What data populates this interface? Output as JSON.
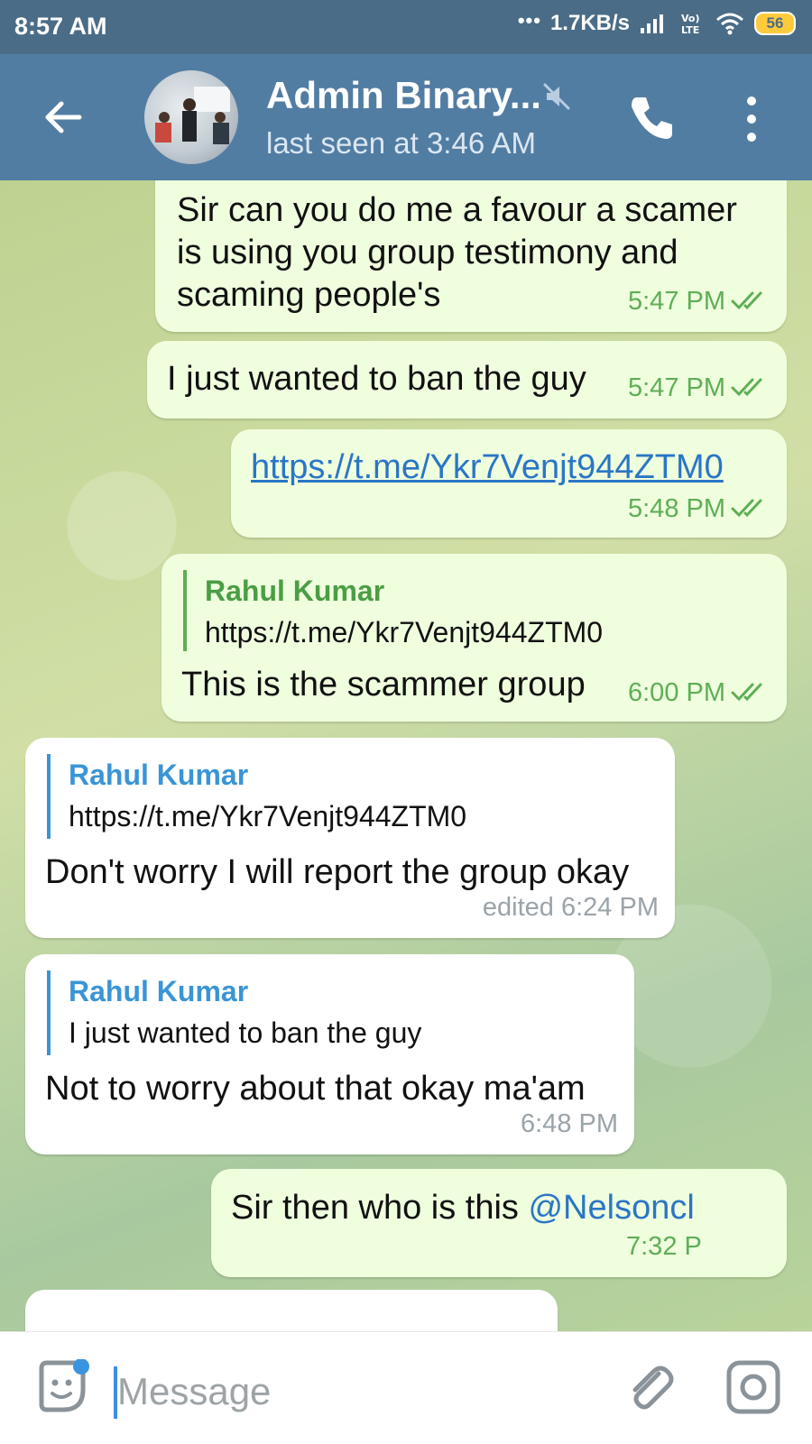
{
  "status_bar": {
    "time": "8:57 AM",
    "dots": "•••",
    "network_speed": "1.7KB/s",
    "battery": "56",
    "icons": [
      "signal-icon",
      "volte-icon",
      "wifi-icon",
      "battery-icon"
    ]
  },
  "header": {
    "title": "Admin Binary...",
    "subtitle": "last seen at 3:46 AM",
    "icons": [
      "back-arrow-icon",
      "avatar",
      "mute-icon",
      "phone-icon",
      "more-vert-icon"
    ]
  },
  "messages": [
    {
      "direction": "outgoing",
      "lines": [
        "Sir can you do me a favour a scamer",
        "is using you group testimony and",
        "scaming people's"
      ],
      "time": "5:47 PM",
      "read": true
    },
    {
      "direction": "outgoing",
      "text": "I just wanted to ban the guy",
      "time": "5:47 PM",
      "read": true
    },
    {
      "direction": "outgoing",
      "link": "https://t.me/Ykr7Venjt944ZTM0",
      "time": "5:48 PM",
      "read": true
    },
    {
      "direction": "outgoing",
      "reply_author": "Rahul Kumar",
      "reply_text": "https://t.me/Ykr7Venjt944ZTM0",
      "text": "This is the scammer group",
      "time": "6:00 PM",
      "read": true
    },
    {
      "direction": "incoming",
      "reply_author": "Rahul Kumar",
      "reply_text": "https://t.me/Ykr7Venjt944ZTM0",
      "text": "Don't worry I will report the group okay",
      "time": "edited 6:24 PM"
    },
    {
      "direction": "incoming",
      "reply_author": "Rahul Kumar",
      "reply_text": "I just wanted to ban the guy",
      "text": "Not to worry about that okay ma'am",
      "time": "6:48 PM"
    },
    {
      "direction": "outgoing",
      "text_prefix": "Sir then who is this ",
      "mention": "@Nelsoncl",
      "time": "7:32 P"
    }
  ],
  "input_bar": {
    "placeholder": "Message",
    "icons": [
      "sticker-icon",
      "attach-icon",
      "camera-icon"
    ]
  },
  "colors": {
    "status_bar": "#4a6c86",
    "header": "#527da3",
    "outgoing_bubble": "#efffde",
    "incoming_bubble": "#ffffff",
    "outgoing_time": "#5eae55",
    "reply_out": "#4a9e44",
    "reply_in": "#3a95d6",
    "link": "#2a76c6"
  }
}
